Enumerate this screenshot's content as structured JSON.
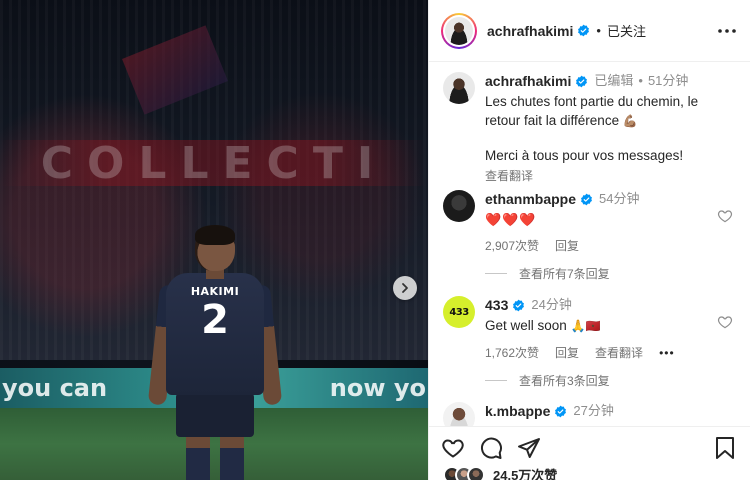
{
  "photo": {
    "banner_text": "COLLECTI",
    "player_name": "HAKIMI",
    "player_number": "2",
    "ad_left": "you can",
    "ad_right": "now yo"
  },
  "header": {
    "username": "achrafhakimi",
    "follow_state": "已关注",
    "separator": "•"
  },
  "caption": {
    "username": "achrafhakimi",
    "edited": "已编辑",
    "separator": "•",
    "time": "51分钟",
    "text_line1": "Les chutes font partie du chemin, le",
    "text_line2": "retour fait la différence",
    "text_line2_emoji": "💪🏽",
    "text_line3": "Merci à tous pour vos messages!",
    "see_translation": "查看翻译"
  },
  "comments": [
    {
      "username": "ethanmbappe",
      "time": "54分钟",
      "text": "❤️❤️❤️",
      "likes": "2,907次赞",
      "reply": "回复",
      "view_replies": "查看所有7条回复"
    },
    {
      "username": "433",
      "time": "24分钟",
      "text": "Get well soon",
      "text_emoji": "🙏🇲🇦",
      "likes": "1,762次赞",
      "reply": "回复",
      "see_translation": "查看翻译",
      "more": "•••",
      "view_replies": "查看所有3条回复"
    },
    {
      "username": "k.mbappe",
      "time": "27分钟"
    }
  ],
  "footer": {
    "likes": "24.5万次赞"
  },
  "colors": {
    "verified": "#0095f6",
    "text": "#262626",
    "muted": "#8e8e8e",
    "heart": "#ed4956",
    "badge_433": "#d6ef2c"
  },
  "icons": {
    "more": "more-options-icon",
    "next": "chevron-right-icon",
    "like": "heart-icon",
    "comment": "comment-icon",
    "share": "share-icon",
    "save": "bookmark-icon",
    "verified": "verified-badge-icon"
  }
}
